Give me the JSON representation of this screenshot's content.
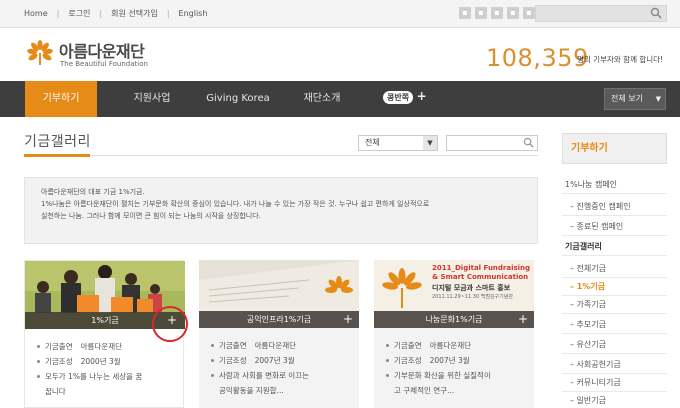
{
  "topbar": {
    "links": [
      "Home",
      "로그인",
      "회원 선택가입",
      "English"
    ]
  },
  "header": {
    "brand_ko": "아름다운재단",
    "brand_en": "The Beautiful Foundation",
    "donor_count": "108,359",
    "donor_text": "명의 기부자와 함께 합니다!"
  },
  "nav": {
    "items": [
      "기부하기",
      "지원사업",
      "Giving Korea",
      "재단소개"
    ],
    "extra": "콩반쪽",
    "select_label": "전체 보기"
  },
  "content": {
    "title": "기금갤러리",
    "filter_value": "전체",
    "intro": [
      "아름다운재단의 대표 기금 1%기금.",
      "1%나눔은 아름다운재단이 펼치는 기부문화 확산의 중심이 있습니다. 내가 나눌 수 있는 가장 작은 것. 누구나 쉽고 편하게 일상적으로",
      "실천하는 나눔. 그러나 함께 모이면 큰 힘이 되는 나눔의 시작을 상징합니다."
    ],
    "cards": [
      {
        "label": "1%기금",
        "donor_key": "기금출연",
        "donor_val": "아름다운재단",
        "date_key": "기금조성",
        "date_val": "2000년 3월",
        "desc": [
          "모두가 1%를 나누는 세상을 꿈",
          "꿉니다"
        ]
      },
      {
        "label": "공익인프라1%기금",
        "donor_key": "기금출연",
        "donor_val": "아름다운재단",
        "date_key": "기금조성",
        "date_val": "2007년 3월",
        "desc": [
          "사람과 사회를 변화로 이끄는",
          "공익활동을 지원합..."
        ]
      },
      {
        "label": "나눔문화1%기금",
        "donor_key": "기금출연",
        "donor_val": "아름다운재단",
        "date_key": "기금조성",
        "date_val": "2007년 3월",
        "desc": [
          "기부문화 확산을 위한 실질적이",
          "고 구체적인 연구..."
        ],
        "poster_title": "2011_Digital Fundraising",
        "poster_sub": "& Smart Communication",
        "poster_ko": "디지털 모금과 스마트 홍보",
        "poster_date": "2011.11.29~11.30 백범김구기념관"
      }
    ]
  },
  "sidebar": {
    "head": "기부하기",
    "items": [
      {
        "label": "1%나눔 캠페인"
      },
      {
        "label": "– 진행중인 캠페인"
      },
      {
        "label": "– 종료된 캠페인"
      },
      {
        "label": "기금갤러리"
      },
      {
        "label": "– 전체기금"
      },
      {
        "label": "– 1%기금"
      },
      {
        "label": "– 가족기금"
      },
      {
        "label": "– 추모기금"
      },
      {
        "label": "– 유산기금"
      },
      {
        "label": "– 사회공헌기금"
      },
      {
        "label": "– 커뮤니티기금"
      },
      {
        "label": "– 일반기금"
      }
    ]
  },
  "colors": {
    "accent": "#e68b17",
    "nav_bg": "#3e3e3e",
    "highlight_circle": "#d8282b"
  }
}
